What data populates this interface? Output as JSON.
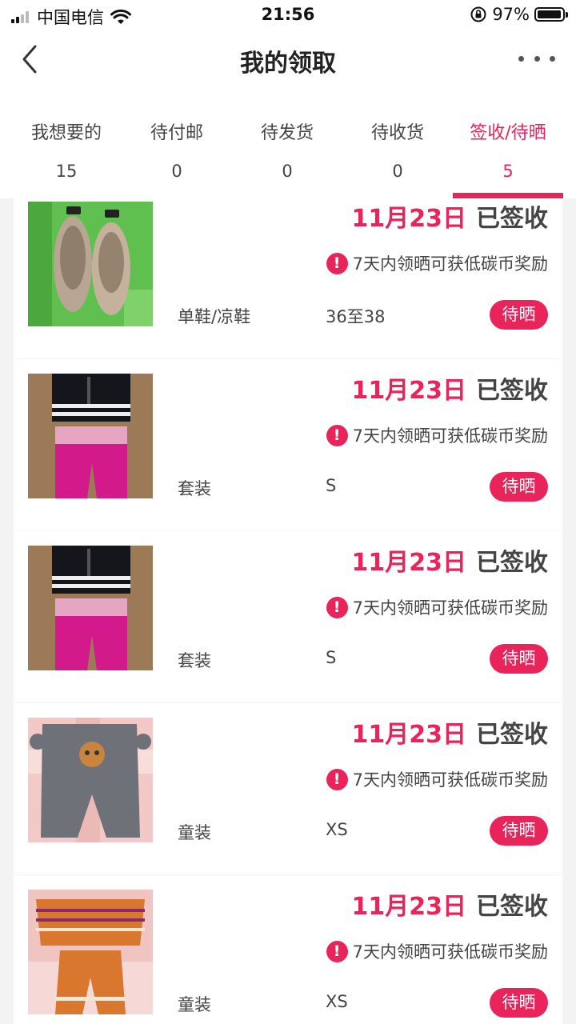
{
  "status_bar": {
    "carrier": "中国电信",
    "time": "21:56",
    "battery": "97%",
    "battery_level": 0.97
  },
  "nav": {
    "title": "我的领取"
  },
  "tabs": [
    {
      "label": "我想要的",
      "count": "15",
      "active": false
    },
    {
      "label": "待付邮",
      "count": "0",
      "active": false
    },
    {
      "label": "待发货",
      "count": "0",
      "active": false
    },
    {
      "label": "待收货",
      "count": "0",
      "active": false
    },
    {
      "label": "签收/待晒",
      "count": "5",
      "active": true
    }
  ],
  "items": [
    {
      "date": "11月23日",
      "status_text": "已签收",
      "reward": "7天内领晒可获低碳币奖励",
      "category": "单鞋/凉鞋",
      "size": "36至38",
      "action": "待晒",
      "image": "shoes-photo"
    },
    {
      "date": "11月23日",
      "status_text": "已签收",
      "reward": "7天内领晒可获低碳币奖励",
      "category": "套装",
      "size": "S",
      "action": "待晒",
      "image": "top-and-pants-photo"
    },
    {
      "date": "11月23日",
      "status_text": "已签收",
      "reward": "7天内领晒可获低碳币奖励",
      "category": "套装",
      "size": "S",
      "action": "待晒",
      "image": "top-and-pants-photo"
    },
    {
      "date": "11月23日",
      "status_text": "已签收",
      "reward": "7天内领晒可获低碳币奖励",
      "category": "童装",
      "size": "XS",
      "action": "待晒",
      "image": "kids-pants-photo"
    },
    {
      "date": "11月23日",
      "status_text": "已签收",
      "reward": "7天内领晒可获低碳币奖励",
      "category": "童装",
      "size": "XS",
      "action": "待晒",
      "image": "kids-knit-set-photo"
    }
  ],
  "colors": {
    "accent": "#e8245a",
    "text": "#444444",
    "background": "#f3f3f3"
  },
  "icons": {
    "back": "chevron-left-icon",
    "more": "more-dots-icon",
    "warning": "exclamation-icon",
    "wifi": "wifi-icon",
    "lock": "rotation-lock-icon"
  }
}
